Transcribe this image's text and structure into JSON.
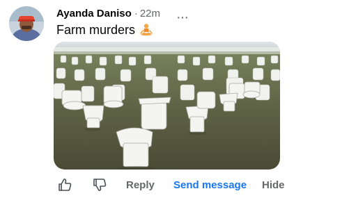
{
  "comment": {
    "author": "Ayanda Daniso",
    "separator": "·",
    "time": "22m",
    "more_label": "···",
    "text": "Farm murders",
    "emoji_icon": "person-in-lotus-position-icon",
    "media_icon": "toilets-in-field-photo"
  },
  "actions": {
    "like_icon": "thumbs-up-icon",
    "dislike_icon": "thumbs-down-icon",
    "reply_label": "Reply",
    "send_message_label": "Send message",
    "hide_label": "Hide"
  },
  "colors": {
    "link": "#1877f2",
    "secondary_text": "#65676b",
    "primary_text": "#050505"
  }
}
